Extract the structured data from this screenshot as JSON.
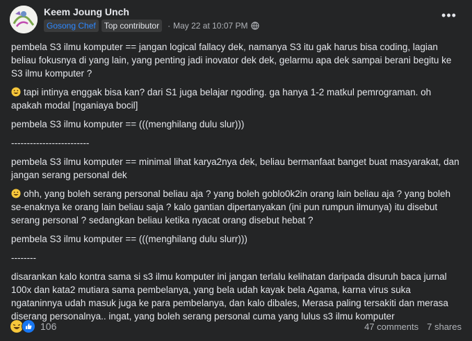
{
  "post": {
    "author": "Keem Joung Unch",
    "badge_chef": "Gosong Chef",
    "badge_top": "Top contributor",
    "separator": "·",
    "timestamp": "May 22 at 10:07 PM",
    "privacy_icon": "globe-icon",
    "more_label": "•••"
  },
  "content": {
    "p1": "pembela S3 ilmu komputer == jangan logical fallacy dek, namanya S3 itu gak harus bisa coding, lagian beliau fokusnya di yang lain, yang penting jadi inovator dek dek, gelarmu apa dek sampai berani begitu ke S3 ilmu komputer ?",
    "p2": "tapi intinya enggak bisa kan? dari S1 juga belajar ngoding. ga hanya 1-2 matkul pemrograman. oh apakah modal [nganiaya bocil]",
    "p3": "pembela S3 ilmu komputer == (((menghilang dulu slur)))",
    "p4": "-------------------------",
    "p5": "pembela S3 ilmu komputer == minimal lihat karya2nya dek, beliau bermanfaat banget buat masyarakat, dan jangan serang personal dek",
    "p6": "ohh, yang boleh serang personal beliau aja ? yang boleh goblo0k2in orang lain beliau aja ? yang boleh se-enaknya ke orang lain beliau saja ? kalo gantian dipertanyakan (ini pun rumpun ilmunya) itu disebut serang personal ? sedangkan beliau ketika nyacat orang disebut hebat ?",
    "p7": "pembela S3 ilmu komputer == (((menghilang dulu slurr)))",
    "p8": "--------",
    "p9": "disarankan kalo kontra sama si s3 ilmu komputer ini jangan terlalu kelihatan daripada disuruh baca jurnal 100x dan kata2 mutiara sama pembelanya, yang bela udah kayak bela Agama, karna virus suka ngataninnya udah masuk juga ke para pembelanya, dan kalo dibales, Merasa paling tersakiti dan merasa diserang personalnya.. ingat, yang boleh serang personal cuma yang lulus s3 ilmu komputer"
  },
  "footer": {
    "reaction_count": "106",
    "comments": "47 comments",
    "shares": "7 shares"
  },
  "colors": {
    "background": "#242526",
    "text": "#e4e6eb",
    "muted": "#b0b3b8",
    "link": "#2d88ff"
  }
}
